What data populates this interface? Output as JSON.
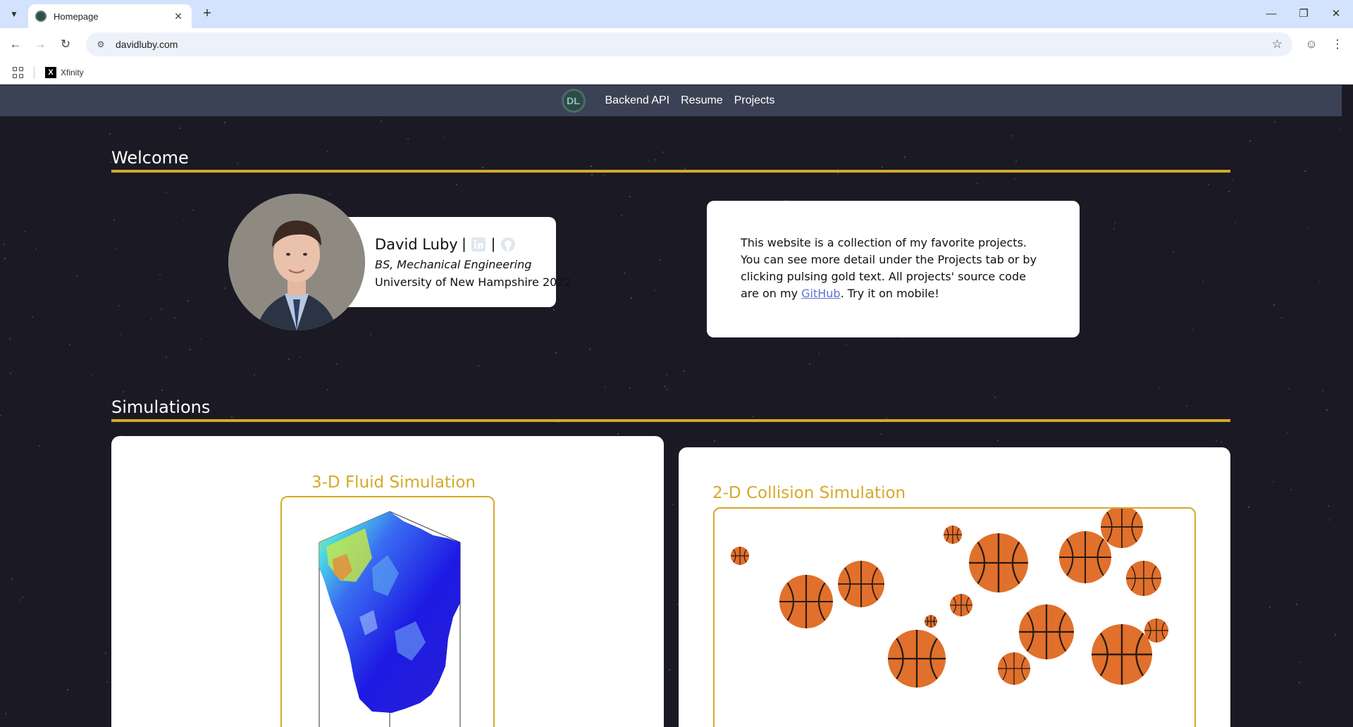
{
  "browser": {
    "tab_title": "Homepage",
    "url": "davidluby.com",
    "bookmark_label": "Xfinity",
    "icons": [
      "tab-list-icon",
      "close-icon",
      "plus-icon",
      "minimize-icon",
      "restore-icon",
      "close-window-icon",
      "back-arrow-icon",
      "forward-arrow-icon",
      "reload-icon",
      "site-info-icon",
      "bookmark-star-icon",
      "profile-icon",
      "more-menu-icon",
      "apps-grid-icon",
      "xfinity-icon"
    ]
  },
  "nav": {
    "links": [
      "Backend API",
      "Resume",
      "Projects"
    ]
  },
  "welcome": {
    "heading": "Welcome",
    "name": "David Luby",
    "separator": "|",
    "degree": "BS, Mechanical Engineering",
    "school": "University of New Hampshire 2022",
    "intro_before": "This website is a collection of my favorite projects. You can see more detail under the Projects tab or by clicking pulsing gold text. All projects' source code are on my ",
    "intro_link": "GitHub",
    "intro_after": ". Try it on mobile!"
  },
  "simulations": {
    "heading": "Simulations",
    "fluid_title": "3-D Fluid Simulation",
    "collision_title": "2-D Collision Simulation"
  },
  "colors": {
    "gold": "#d4a92a",
    "page_bg": "#1b1a24",
    "nav_bg": "#3c4256",
    "ball": "#e0702c"
  }
}
